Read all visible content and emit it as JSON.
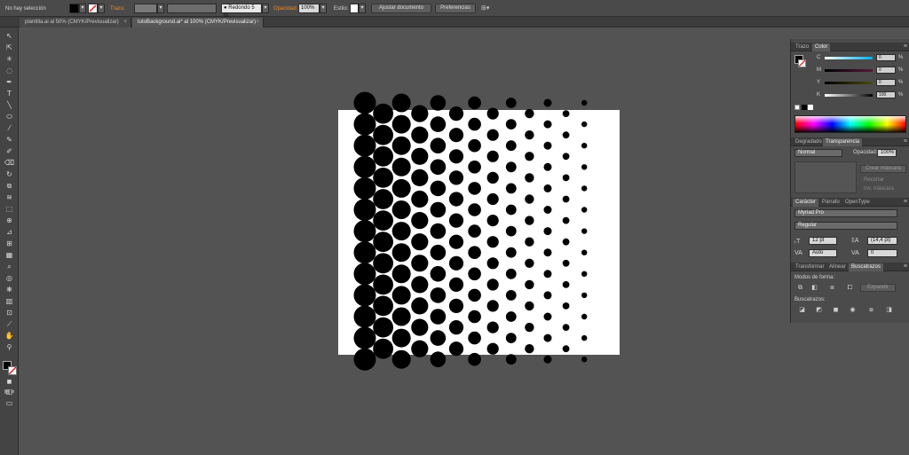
{
  "control_bar": {
    "selection": "No hay selección",
    "stroke_label": "Trazo:",
    "brush": "Redondo 5 pt.",
    "opacity_label": "Opacidad:",
    "opacity_value": "100%",
    "style_label": "Estilo:",
    "doc_setup_button": "Ajustar documento",
    "preferences_button": "Preferencias",
    "fill_color": "#000000",
    "stroke_color": "#ffffff",
    "accent": "#e88a2a"
  },
  "tabs": [
    {
      "label": "plantilla.ai al 50% (CMYK/Previsualizar)",
      "close": "×"
    },
    {
      "label": "tutoBackground.ai* al 100% (CMYK/Previsualizar)",
      "close": "×"
    }
  ],
  "toolbox": {
    "tools": [
      "selection-tool",
      "direct-selection-tool",
      "magic-wand-tool",
      "lasso-tool",
      "pen-tool",
      "type-tool",
      "line-tool",
      "rectangle-tool",
      "paintbrush-tool",
      "pencil-tool",
      "blob-brush-tool",
      "eraser-tool",
      "rotate-tool",
      "scale-tool",
      "warp-tool",
      "free-transform-tool",
      "shape-builder-tool",
      "perspective-tool",
      "mesh-tool",
      "gradient-tool",
      "eyedropper-tool",
      "blend-tool",
      "symbol-sprayer-tool",
      "graph-tool",
      "artboard-tool",
      "slice-tool",
      "hand-tool",
      "zoom-tool"
    ]
  },
  "panels": {
    "color": {
      "tabs": [
        "Trazo",
        "Color"
      ],
      "channels": [
        {
          "label": "C",
          "value": "0",
          "unit": "%"
        },
        {
          "label": "M",
          "value": "0",
          "unit": "%"
        },
        {
          "label": "Y",
          "value": "0",
          "unit": "%"
        },
        {
          "label": "K",
          "value": "100",
          "unit": "%"
        }
      ]
    },
    "transparency": {
      "tabs": [
        "Degradado",
        "Transparencia"
      ],
      "blend_mode": "Normal",
      "opacity_label": "Opacidad:",
      "opacity_value": "100%",
      "make_mask_button": "Crear máscara",
      "clip_label": "Recortar",
      "invert_mask_label": "Inv. máscara"
    },
    "character": {
      "tabs": [
        "Carácter",
        "Párrafo",
        "OpenType"
      ],
      "font_family": "Myriad Pro",
      "font_style": "Regular",
      "font_size": "12 pt",
      "leading": "(14,4 pt)",
      "kerning": "Auto",
      "tracking": "0"
    },
    "pathfinder": {
      "tabs": [
        "Transformar",
        "Alinear",
        "Buscatrazos"
      ],
      "shape_modes_label": "Modos de forma:",
      "expand_button": "Expandir",
      "pathfinders_label": "Buscatrazos:"
    }
  }
}
